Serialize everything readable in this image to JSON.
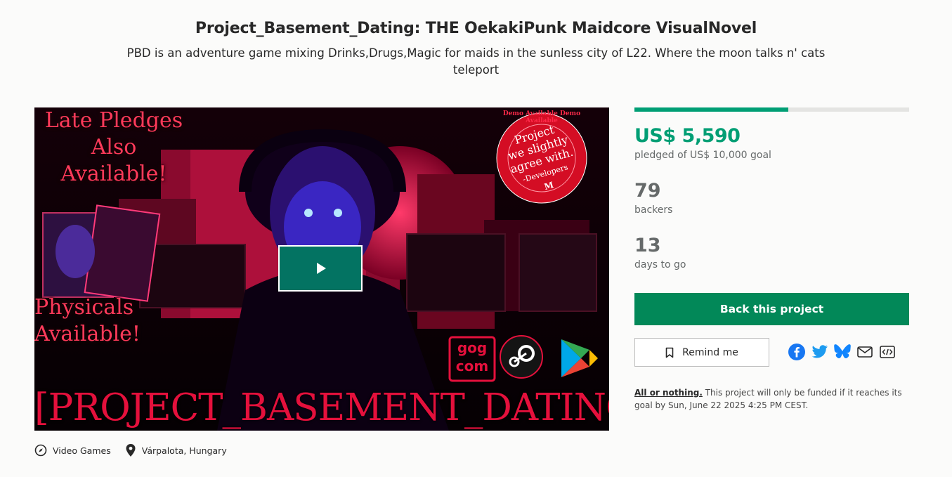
{
  "project": {
    "title": "Project_Basement_Dating: THE OekakiPunk Maidcore VisualNovel",
    "blurb": "PBD is an adventure game mixing Drinks,Drugs,Magic for maids in the sunless city of L22. Where the moon talks n' cats teleport"
  },
  "media": {
    "late_line1": "Late Pledges",
    "late_line2": "Also Available!",
    "physicals_line1": "Physicals",
    "physicals_line2": "Available!",
    "badge_line1": "Project",
    "badge_line2": "we slightly",
    "badge_line3": "agree with.",
    "badge_line4": "-Developers",
    "badge_mark": "M",
    "badge_ring": "Demo Available Demo Available",
    "game_title": "[PROJECT_BASEMENT_DATING]",
    "gog_line1": "gog",
    "gog_line2": "com",
    "play_icon": "play-icon"
  },
  "tags": {
    "category": "Video Games",
    "location": "Várpalota, Hungary"
  },
  "funding": {
    "progress_fraction": 0.559,
    "pledged": "US$ 5,590",
    "goal_text": "pledged of US$ 10,000 goal",
    "backers_count": "79",
    "backers_label": "backers",
    "days_count": "13",
    "days_label": "days to go"
  },
  "actions": {
    "back_label": "Back this project",
    "remind_label": "Remind me"
  },
  "share_icons": [
    "facebook-icon",
    "twitter-icon",
    "bluesky-icon",
    "email-icon",
    "embed-icon"
  ],
  "fine_print": {
    "link": "All or nothing.",
    "text": " This project will only be funded if it reaches its goal by Sun, June 22 2025 4:25 PM CEST."
  },
  "colors": {
    "accent_green": "#009e74",
    "button_green": "#028858",
    "play_button": "#037362"
  }
}
